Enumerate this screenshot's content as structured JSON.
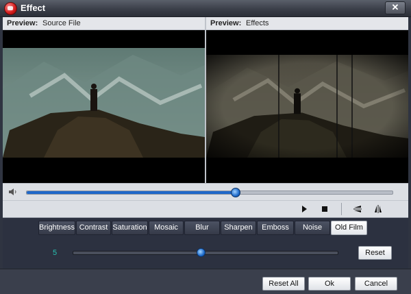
{
  "window": {
    "title": "Effect",
    "close_label": "✕"
  },
  "preview": {
    "source": {
      "label": "Preview:",
      "value": "Source File"
    },
    "effects": {
      "label": "Preview:",
      "value": "Effects"
    }
  },
  "timeline": {
    "position_fraction": 0.57
  },
  "controls": {
    "play_icon": "play-icon",
    "stop_icon": "stop-icon",
    "flip_vertical_icon": "flip-vertical-icon",
    "flip_horizontal_icon": "flip-horizontal-icon"
  },
  "effects": {
    "tabs": [
      "Brightness",
      "Contrast",
      "Saturation",
      "Mosaic",
      "Blur",
      "Sharpen",
      "Emboss",
      "Noise",
      "Old Film"
    ],
    "selected": "Old Film"
  },
  "param": {
    "value": "5",
    "level_fraction": 0.48,
    "reset_label": "Reset"
  },
  "footer": {
    "reset_all_label": "Reset All",
    "ok_label": "Ok",
    "cancel_label": "Cancel"
  },
  "colors": {
    "accent": "#1f68c9",
    "value_text": "#27c4b4"
  }
}
